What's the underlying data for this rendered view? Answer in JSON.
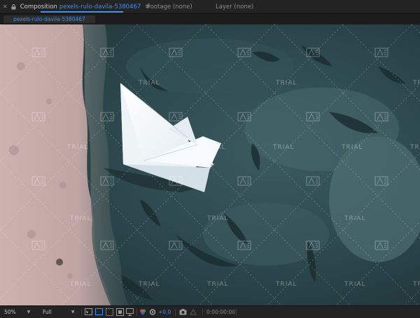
{
  "panel_tabs": {
    "composition_label": "Composition",
    "composition_name": "pexels-rulo-davila-5380467",
    "footage_label": "Footage (none)",
    "layer_label": "Layer (none)"
  },
  "breadcrumb": {
    "label": "pexels-rulo-davila-5380467"
  },
  "viewer": {
    "watermark_text": "TRIAL",
    "watermark_icon": "after-effects-logo-icon"
  },
  "controls": {
    "zoom": "50%",
    "resolution": "Full",
    "exposure": "+0,0",
    "timecode": "0:00:00:00"
  },
  "colors": {
    "accent_blue": "#3d8ff0",
    "panel_bg": "#232323",
    "water": "#2c4a4f",
    "sand": "#c9aeab"
  }
}
